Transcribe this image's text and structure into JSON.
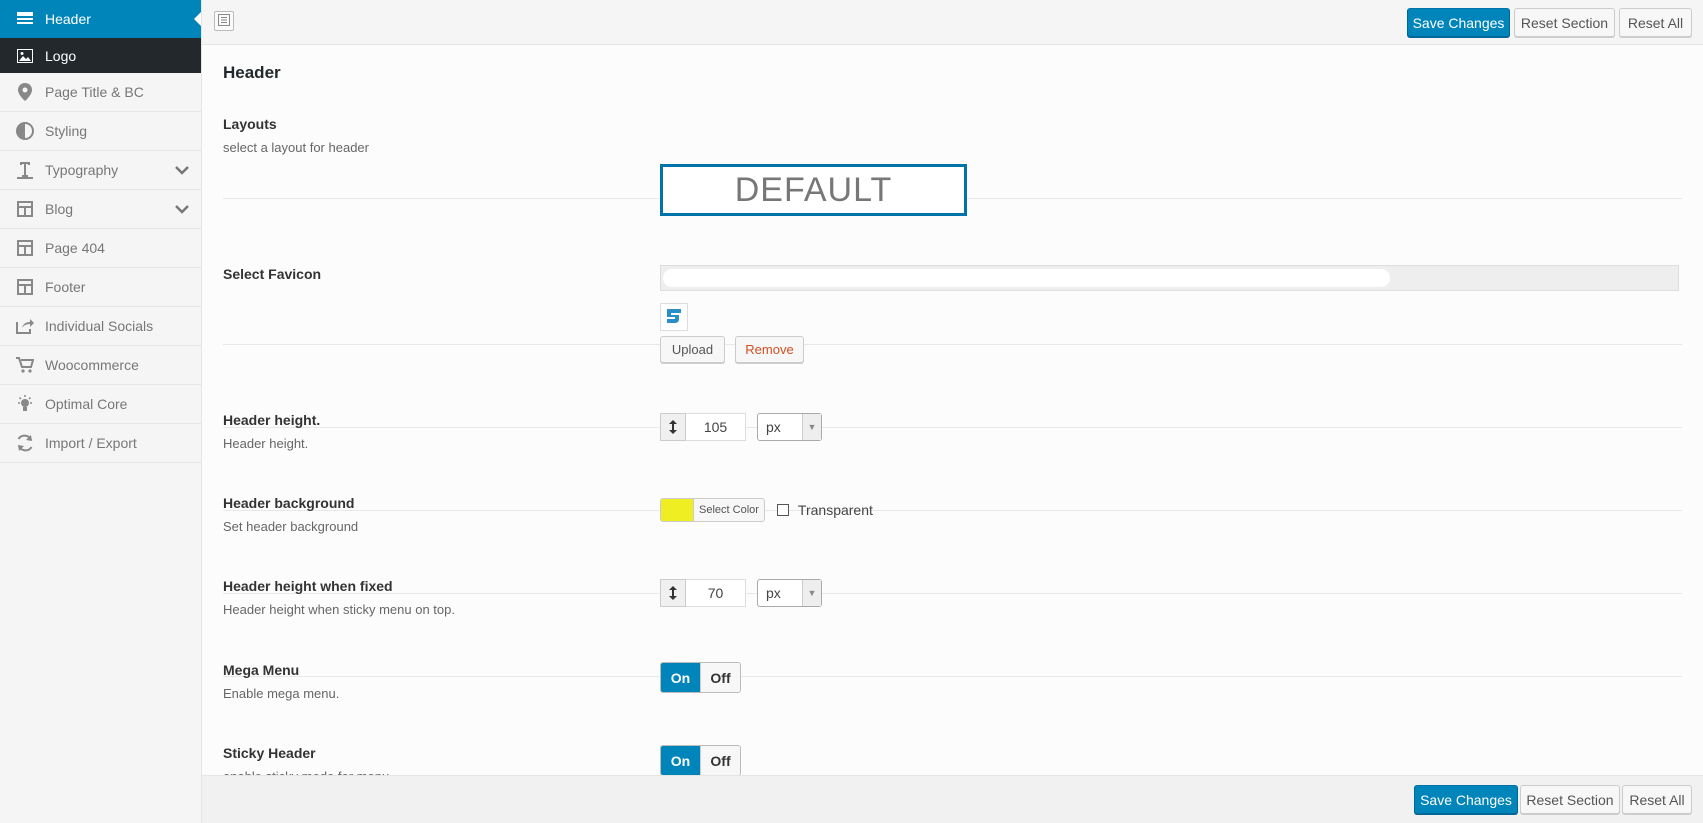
{
  "sidebar": {
    "items": [
      {
        "label": "Header",
        "icon": "header-icon"
      },
      {
        "label": "Logo",
        "icon": "image-icon"
      },
      {
        "label": "Page Title & BC",
        "icon": "location-pin-icon"
      },
      {
        "label": "Styling",
        "icon": "contrast-icon"
      },
      {
        "label": "Typography",
        "icon": "text-icon"
      },
      {
        "label": "Blog",
        "icon": "layout-icon"
      },
      {
        "label": "Page 404",
        "icon": "layout-icon"
      },
      {
        "label": "Footer",
        "icon": "layout-icon"
      },
      {
        "label": "Individual Socials",
        "icon": "share-icon"
      },
      {
        "label": "Woocommerce",
        "icon": "cart-icon"
      },
      {
        "label": "Optimal Core",
        "icon": "lightbulb-icon"
      },
      {
        "label": "Import / Export",
        "icon": "refresh-icon"
      }
    ]
  },
  "toolbar": {
    "save": "Save Changes",
    "reset_section": "Reset Section",
    "reset_all": "Reset All"
  },
  "section": {
    "title": "Header"
  },
  "fields": {
    "layouts": {
      "label": "Layouts",
      "desc": "select a layout for header",
      "value": "DEFAULT"
    },
    "favicon": {
      "label": "Select Favicon",
      "upload": "Upload",
      "remove": "Remove"
    },
    "header_height": {
      "label": "Header height.",
      "desc": "Header height.",
      "value": "105",
      "unit": "px"
    },
    "header_bg": {
      "label": "Header background",
      "desc": "Set header background",
      "button": "Select Color",
      "color": "#eeee22",
      "transparent_label": "Transparent"
    },
    "fixed_height": {
      "label": "Header height when fixed",
      "desc": "Header height when sticky menu on top.",
      "value": "70",
      "unit": "px"
    },
    "mega_menu": {
      "label": "Mega Menu",
      "desc": "Enable mega menu.",
      "on": "On",
      "off": "Off"
    },
    "sticky": {
      "label": "Sticky Header",
      "desc": "enable sticky mode for menu.",
      "on": "On",
      "off": "Off"
    }
  },
  "colors": {
    "accent": "#0085ba",
    "remove_text": "#d54e21"
  }
}
